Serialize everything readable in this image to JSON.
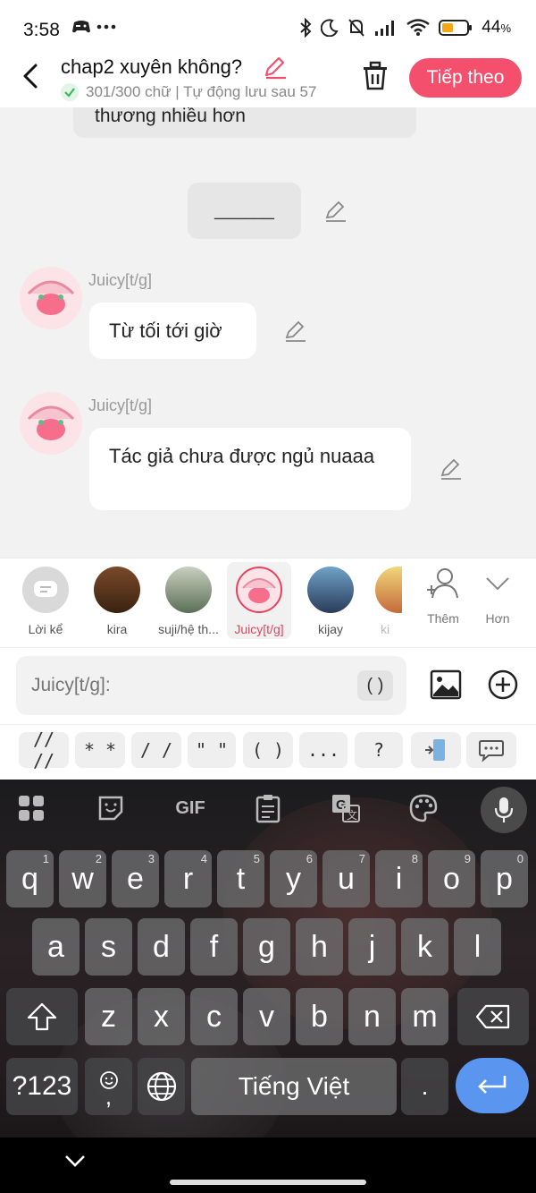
{
  "status_bar": {
    "time": "3:58",
    "battery_percent": "44",
    "battery_suffix": "%"
  },
  "header": {
    "title": "chap2 xuyên không?",
    "save_status": "301/300 chữ | Tự động lưu sau 57",
    "next_button": "Tiếp theo"
  },
  "chat": {
    "partial_message": "thương nhiều hơn",
    "narration": "______",
    "messages": [
      {
        "sender": "Juicy[t/g]",
        "text": "Từ tối tới giờ"
      },
      {
        "sender": "Juicy[t/g]",
        "text": "Tác giả chưa được ngủ nuaaa"
      }
    ]
  },
  "characters": {
    "items": [
      {
        "label": "Lời kể"
      },
      {
        "label": "kira"
      },
      {
        "label": "suji/hệ th..."
      },
      {
        "label": "Juicy[t/g]"
      },
      {
        "label": "kijay"
      },
      {
        "label": "ki"
      }
    ],
    "add_label": "Thêm",
    "more_label": "Hơn"
  },
  "composer": {
    "placeholder": "Juicy[t/g]:",
    "paren_chip": "( )"
  },
  "punctuation": [
    "// //",
    "* *",
    "/ /",
    "\" \"",
    "( )",
    "...",
    "?"
  ],
  "keyboard": {
    "gif_label": "GIF",
    "row1": [
      {
        "k": "q",
        "h": "1"
      },
      {
        "k": "w",
        "h": "2"
      },
      {
        "k": "e",
        "h": "3"
      },
      {
        "k": "r",
        "h": "4"
      },
      {
        "k": "t",
        "h": "5"
      },
      {
        "k": "y",
        "h": "6"
      },
      {
        "k": "u",
        "h": "7"
      },
      {
        "k": "i",
        "h": "8"
      },
      {
        "k": "o",
        "h": "9"
      },
      {
        "k": "p",
        "h": "0"
      }
    ],
    "row2": [
      "a",
      "s",
      "d",
      "f",
      "g",
      "h",
      "j",
      "k",
      "l"
    ],
    "row3": [
      "z",
      "x",
      "c",
      "v",
      "b",
      "n",
      "m"
    ],
    "symbols_key": "?123",
    "emoji_comma": ",",
    "space_label": "Tiếng Việt",
    "period_key": "."
  },
  "colors": {
    "accent": "#f4506e",
    "enter": "#5a95f0"
  }
}
